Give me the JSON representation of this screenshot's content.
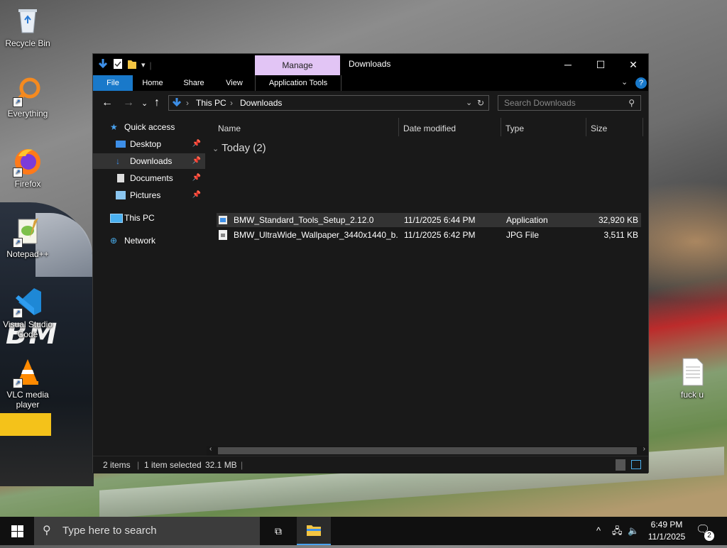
{
  "desktop": {
    "icons": [
      {
        "label": "Recycle Bin",
        "icon": "recycle-bin-icon"
      },
      {
        "label": "Everything",
        "icon": "everything-search-icon"
      },
      {
        "label": "Firefox",
        "icon": "firefox-icon"
      },
      {
        "label": "Notepad++",
        "icon": "notepad-plus-plus-icon"
      },
      {
        "label": "Visual Studio Code",
        "icon": "vscode-icon"
      },
      {
        "label": "VLC media player",
        "icon": "vlc-icon"
      },
      {
        "label": "fuck u",
        "icon": "text-file-icon"
      }
    ]
  },
  "explorer": {
    "title": "Downloads",
    "manage_tab": "Manage",
    "ribbon_tabs": [
      "File",
      "Home",
      "Share",
      "View",
      "Application Tools"
    ],
    "address": {
      "crumbs": [
        "This PC",
        "Downloads"
      ]
    },
    "search_placeholder": "Search Downloads",
    "nav": {
      "quick_access": "Quick access",
      "items": [
        "Desktop",
        "Downloads",
        "Documents",
        "Pictures"
      ],
      "this_pc": "This PC",
      "network": "Network"
    },
    "columns": [
      "Name",
      "Date modified",
      "Type",
      "Size"
    ],
    "group_label": "Today (2)",
    "files": [
      {
        "name": "BMW_Standard_Tools_Setup_2.12.0",
        "date": "11/1/2025 6:44 PM",
        "type": "Application",
        "size": "32,920 KB"
      },
      {
        "name": "BMW_UltraWide_Wallpaper_3440x1440_b...",
        "date": "11/1/2025 6:42 PM",
        "type": "JPG File",
        "size": "3,511 KB"
      }
    ],
    "status": {
      "items": "2 items",
      "selected": "1 item selected",
      "selected_size": "32.1 MB"
    }
  },
  "taskbar": {
    "search_placeholder": "Type here to search",
    "time": "6:49 PM",
    "date": "11/1/2025",
    "notification_count": "2"
  },
  "wallpaper_text": "BM"
}
